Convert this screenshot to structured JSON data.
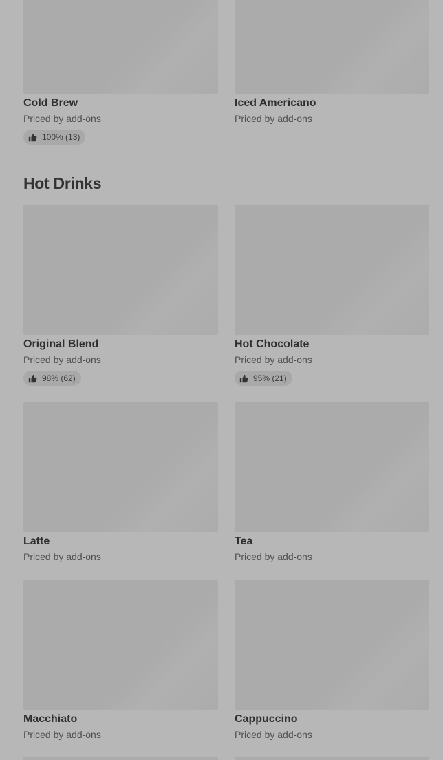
{
  "items_top": [
    {
      "name": "Cold Brew",
      "price": "Priced by add-ons",
      "rating": "100% (13)"
    },
    {
      "name": "Iced Americano",
      "price": "Priced by add-ons"
    }
  ],
  "section": {
    "title": "Hot Drinks",
    "items": [
      {
        "name": "Original Blend",
        "price": "Priced by add-ons",
        "rating": "98% (62)"
      },
      {
        "name": "Hot Chocolate",
        "price": "Priced by add-ons",
        "rating": "95% (21)"
      },
      {
        "name": "Latte",
        "price": "Priced by add-ons"
      },
      {
        "name": "Tea",
        "price": "Priced by add-ons"
      },
      {
        "name": "Macchiato",
        "price": "Priced by add-ons"
      },
      {
        "name": "Cappuccino",
        "price": "Priced by add-ons"
      }
    ]
  },
  "icons": {
    "rating": "thumbs-up-icon"
  },
  "colors": {
    "background": "#b7b7b7",
    "placeholder": "#ababab",
    "rating_pill": "#a9a9a9"
  }
}
